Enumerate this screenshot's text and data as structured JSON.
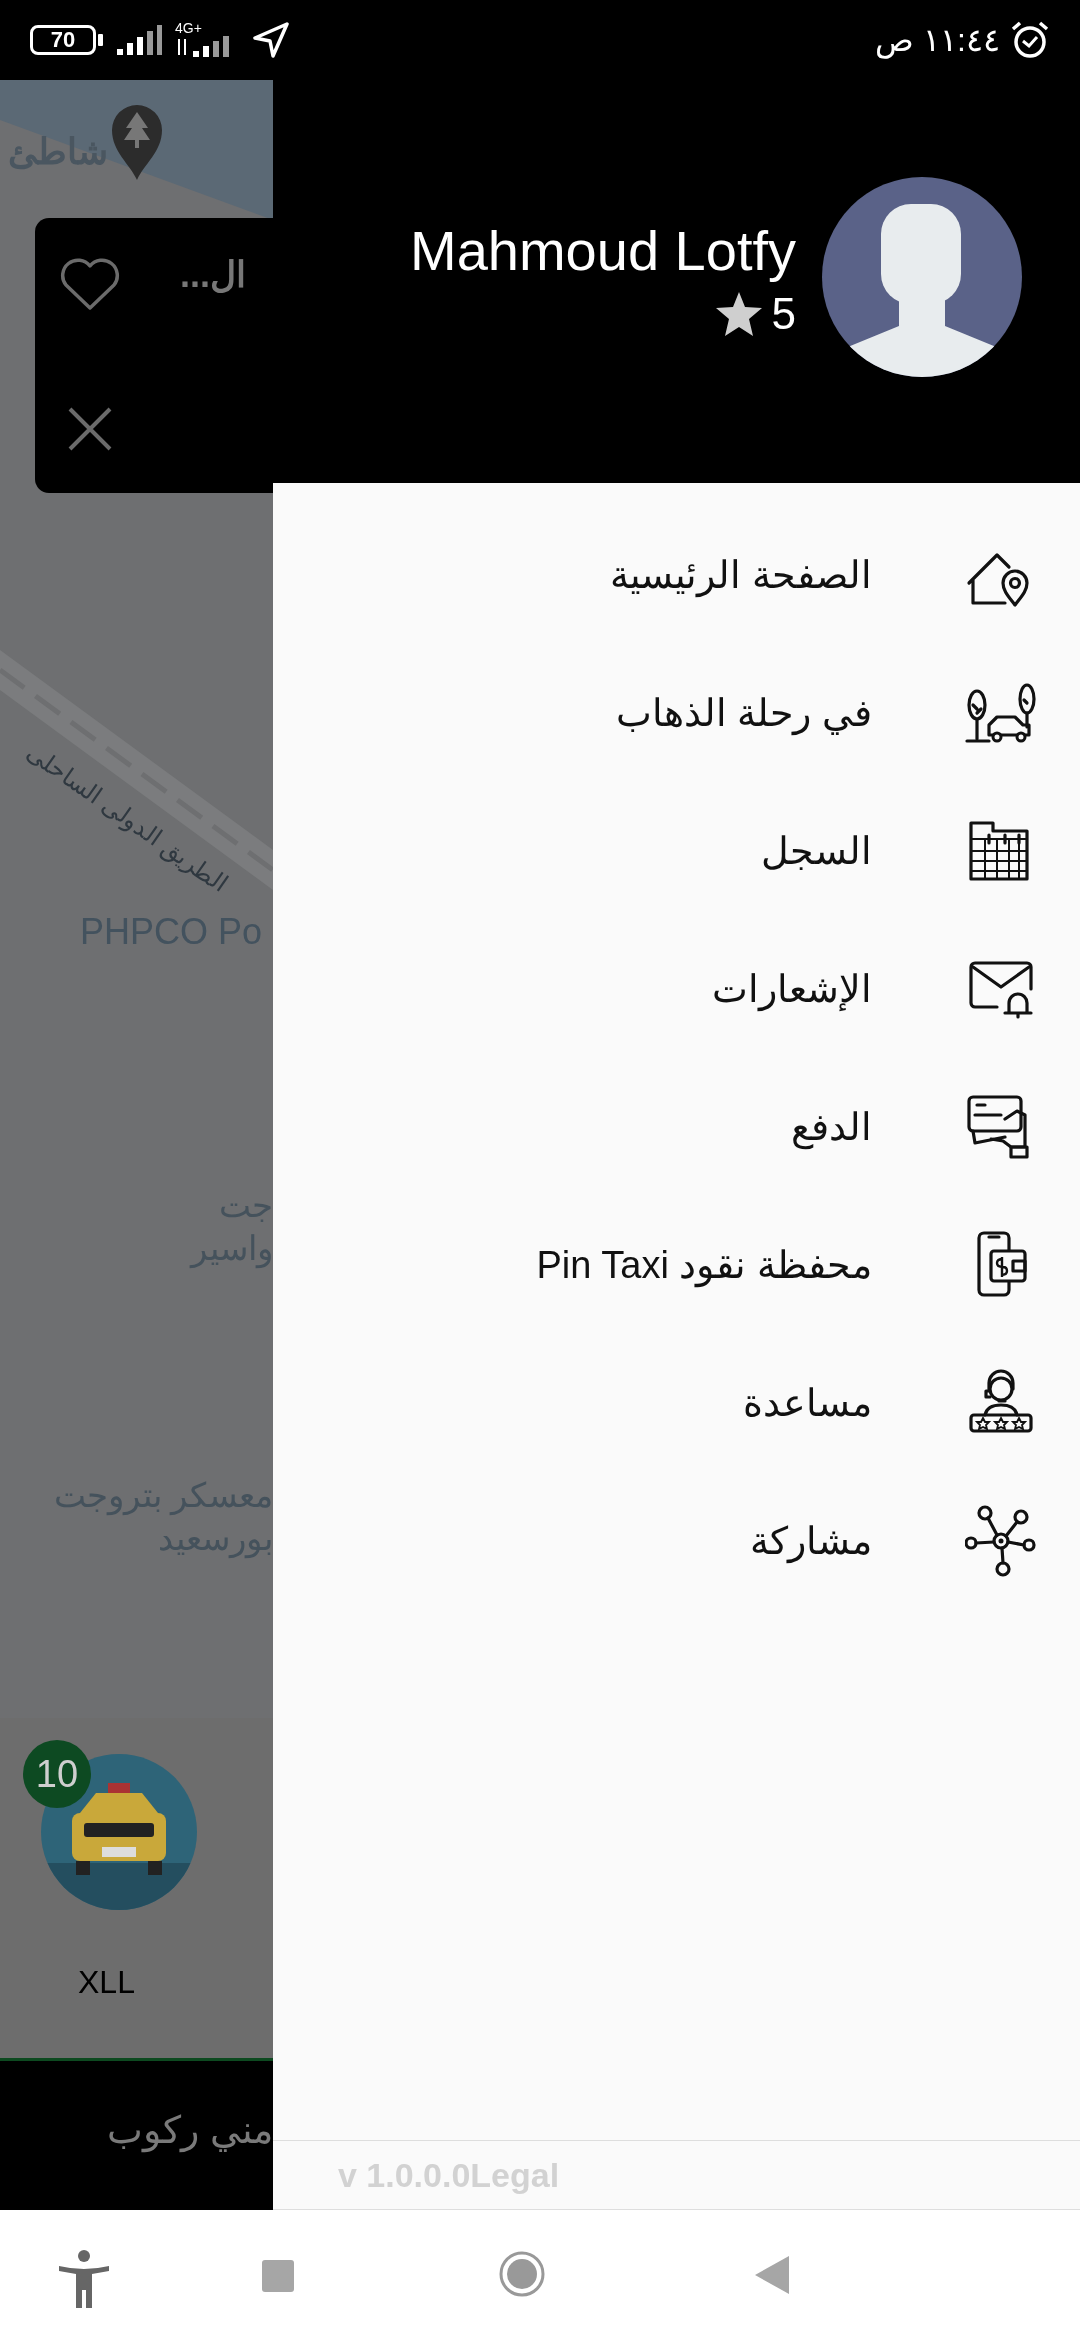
{
  "status_bar": {
    "battery": "70",
    "network": "4G+",
    "time": "١١:٤٤ ص"
  },
  "map": {
    "labels": [
      {
        "text": "شاطئ",
        "kind": "poi"
      },
      {
        "text": "الطريق الدولى الساحلى",
        "kind": "road"
      },
      {
        "text": "PHPCO Po",
        "kind": "place"
      },
      {
        "text": "جت",
        "kind": "area"
      },
      {
        "text": "واسير",
        "kind": "area"
      },
      {
        "text": "معسكر بتروجت",
        "kind": "area"
      },
      {
        "text": "بورسعيد",
        "kind": "area"
      }
    ]
  },
  "place_card": {
    "title": "ال..."
  },
  "vehicle": {
    "badge": "10",
    "name": "XLL"
  },
  "bottom_button": {
    "label": "مني ركوب"
  },
  "drawer": {
    "profile": {
      "name": "Mahmoud Lotfy",
      "rating": "5"
    },
    "menu": [
      {
        "label": "الصفحة الرئيسية",
        "kind": "home"
      },
      {
        "label": "في رحلة الذهاب",
        "kind": "trip"
      },
      {
        "label": "السجل",
        "kind": "history"
      },
      {
        "label": "الإشعارات",
        "kind": "notifications"
      },
      {
        "label": "الدفع",
        "kind": "payment"
      },
      {
        "label": "محفظة نقود Pin Taxi",
        "kind": "wallet"
      },
      {
        "label": "مساعدة",
        "kind": "help"
      },
      {
        "label": "مشاركة",
        "kind": "share"
      }
    ],
    "version": "v 1.0.0.0Legal"
  }
}
